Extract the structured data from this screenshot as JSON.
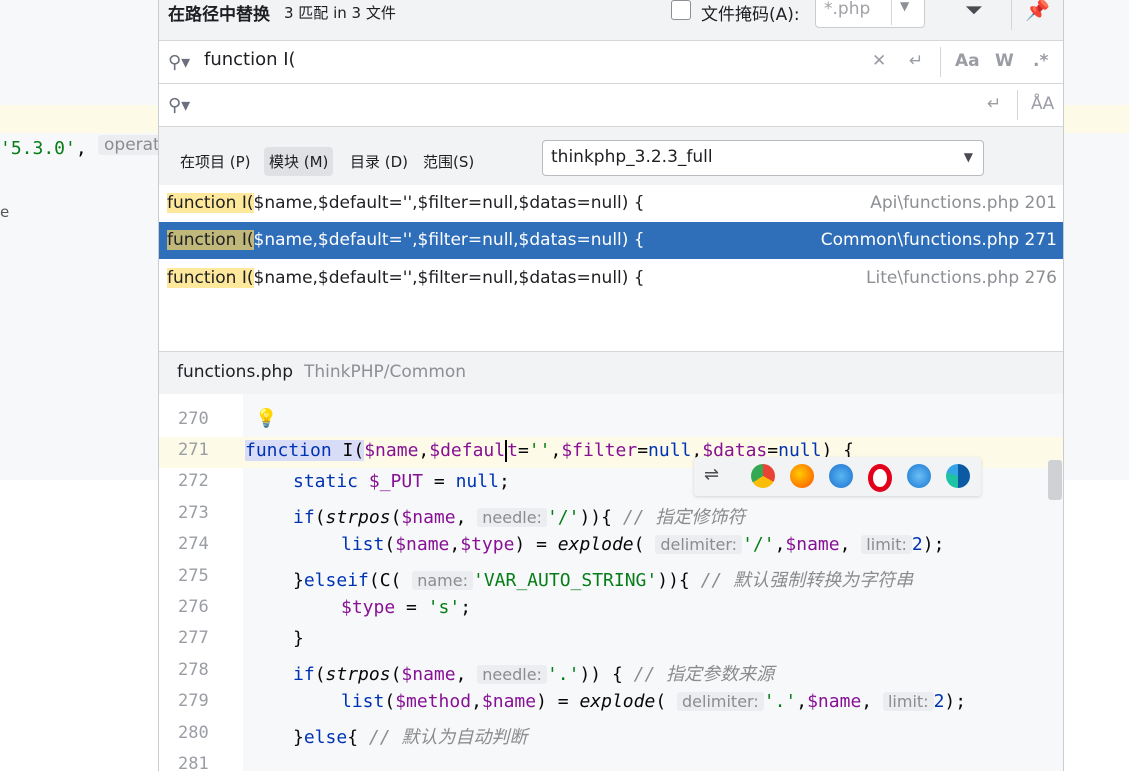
{
  "background": {
    "left_code_str": "'5.3.0'",
    "left_code_comma": ",",
    "left_hint": "operat",
    "left_text": "e"
  },
  "header": {
    "title": "在路径中替换",
    "match_count": "3 匹配 in 3 文件",
    "mask_label": "文件掩码(A):",
    "mask_value": "*.php"
  },
  "search": {
    "query": "function I(",
    "replace": ""
  },
  "search_options": {
    "match_case": "Aa",
    "words": "W",
    "regex": ".*"
  },
  "scope": {
    "tabs": [
      "在项目 (P)",
      "模块 (M)",
      "目录 (D)",
      "范围(S)"
    ],
    "selected_tab": "模块 (M)",
    "module": "thinkphp_3.2.3_full"
  },
  "results": [
    {
      "match": "function I(",
      "rest": "$name,$default='',$filter=null,$datas=null) {",
      "path": "Api\\functions.php 201"
    },
    {
      "match": "function I(",
      "rest": "$name,$default='',$filter=null,$datas=null) {",
      "path": "Common\\functions.php 271"
    },
    {
      "match": "function I(",
      "rest": "$name,$default='',$filter=null,$datas=null) {",
      "path": "Lite\\functions.php 276"
    }
  ],
  "preview": {
    "file": "functions.php",
    "dir": "ThinkPHP/Common",
    "lines": [
      "270",
      "271",
      "272",
      "273",
      "274",
      "275",
      "276",
      "277",
      "278",
      "279",
      "280",
      "281"
    ],
    "hints": {
      "needle": "needle:",
      "delimiter": "delimiter:",
      "limit": "limit:",
      "name": "name:"
    },
    "comments": {
      "c273": "// 指定修饰符",
      "c275": "// 默认强制转换为字符串",
      "c278": "// 指定参数来源",
      "c280": "// 默认为自动判断"
    }
  },
  "colors": {
    "selection": "#2f6fba",
    "match_highlight": "#fde89b",
    "keyword": "#0033b3",
    "variable": "#871094",
    "string": "#067d17"
  }
}
